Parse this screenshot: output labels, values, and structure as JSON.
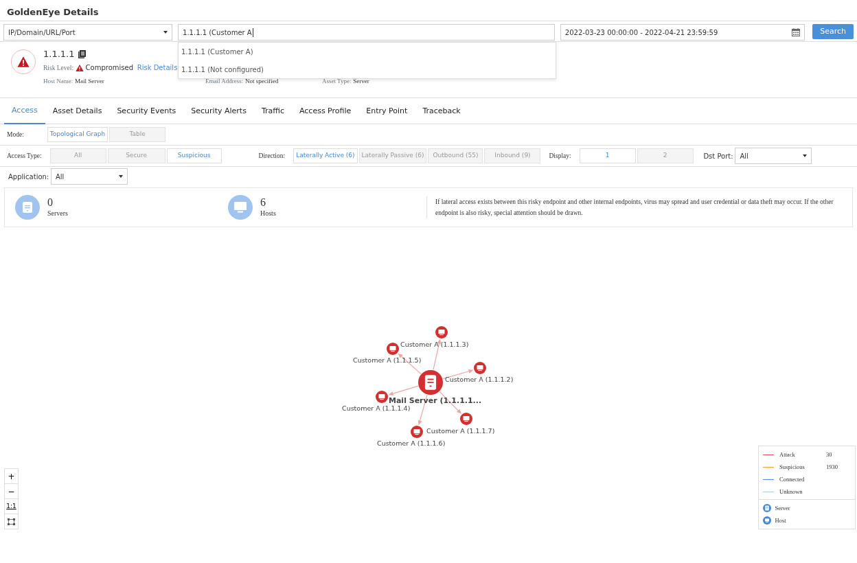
{
  "page_title": "GoldenEye Details",
  "search": {
    "type_select": "IP/Domain/URL/Port",
    "query": "1.1.1.1 (Customer A",
    "suggestions": [
      "1.1.1.1 (Customer A)",
      "1.1.1.1 (Not configured)"
    ],
    "date_range": "2022-03-23 00:00:00 - 2022-04-21 23:59:59",
    "button": "Search"
  },
  "asset": {
    "name": "1.1.1.1",
    "risk_label": "Risk Level:",
    "risk_value": "Compromised",
    "risk_link": "Risk Details",
    "fields": [
      {
        "label": "Host Name:",
        "value": "Mail Server"
      },
      {
        "label": "Email Address:",
        "value": "Not specified"
      },
      {
        "label": "Asset Type:",
        "value": "Server"
      }
    ]
  },
  "tabs": [
    {
      "label": "Access",
      "selected": true
    },
    {
      "label": "Asset Details",
      "selected": false
    },
    {
      "label": "Security Events",
      "selected": false
    },
    {
      "label": "Security Alerts",
      "selected": false
    },
    {
      "label": "Traffic",
      "selected": false
    },
    {
      "label": "Access Profile",
      "selected": false
    },
    {
      "label": "Entry Point",
      "selected": false
    },
    {
      "label": "Traceback",
      "selected": false
    }
  ],
  "filters": {
    "mode": {
      "label": "Mode:",
      "options": [
        {
          "label": "Topological Graph",
          "selected": true
        },
        {
          "label": "Table",
          "selected": false
        }
      ]
    },
    "access_type": {
      "label": "Access Type:",
      "options": [
        {
          "label": "All",
          "selected": false
        },
        {
          "label": "Secure",
          "selected": false
        },
        {
          "label": "Suspicious",
          "selected": true
        }
      ]
    },
    "direction": {
      "label": "Direction:",
      "options": [
        {
          "label": "Laterally Active (6)",
          "selected": true
        },
        {
          "label": "Laterally Passive (6)",
          "selected": false
        },
        {
          "label": "Outbound (55)",
          "selected": false
        },
        {
          "label": "Inbound (9)",
          "selected": false
        }
      ]
    },
    "display": {
      "label": "Display:",
      "options": [
        {
          "label": "1",
          "selected": true
        },
        {
          "label": "2",
          "selected": false
        }
      ]
    },
    "dst_port": {
      "label": "Dst Port:",
      "value": "All"
    },
    "application": {
      "label": "Application:",
      "value": "All"
    }
  },
  "summary": {
    "stats": [
      {
        "kind": "server",
        "count": "0",
        "label": "Servers"
      },
      {
        "kind": "host",
        "count": "6",
        "label": "Hosts"
      }
    ],
    "note": "If lateral access exists between this risky endpoint and other internal endpoints, virus may spread and user credential or data theft may occur. If the other endpoint is also risky, special attention should be drawn."
  },
  "graph": {
    "center": {
      "label": "Mail Server (1.1.1.1..."
    },
    "nodes": [
      {
        "label": "Customer A (1.1.1.3)"
      },
      {
        "label": "Customer A (1.1.1.5)"
      },
      {
        "label": "Customer A (1.1.1.2)"
      },
      {
        "label": "Customer A (1.1.1.4)"
      },
      {
        "label": "Customer A (1.1.1.7)"
      },
      {
        "label": "Customer A (1.1.1.6)"
      }
    ]
  },
  "zoom_controls": [
    "+",
    "−",
    "1:1"
  ],
  "legend": {
    "lines": [
      {
        "label": "Attack",
        "count": "30",
        "color": "#f05050"
      },
      {
        "label": "Suspicious",
        "count": "1930",
        "color": "#f0a040"
      },
      {
        "label": "Connected",
        "color": "#4a8ee0"
      },
      {
        "label": "Unknown",
        "color": "#a8c8f0"
      }
    ],
    "nodes": [
      {
        "kind": "server",
        "label": "Server"
      },
      {
        "kind": "host",
        "label": "Host"
      }
    ]
  }
}
